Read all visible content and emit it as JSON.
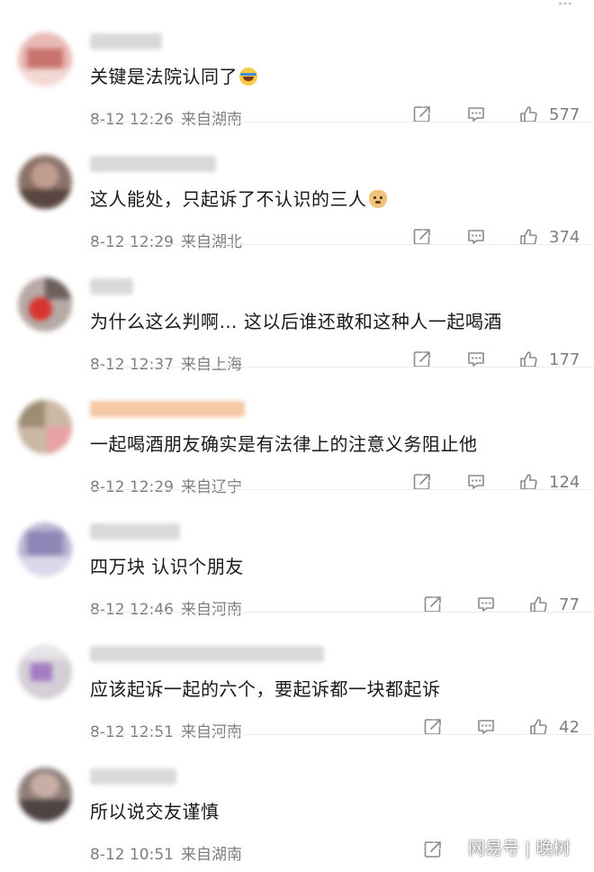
{
  "header_partial_text": "...",
  "colors": {
    "meta_gray": "#7d7d7d",
    "icon_gray": "#8a8a8a"
  },
  "comments": [
    {
      "text": "关键是法院认同了",
      "emoji": "laugh-cry-emoji",
      "date": "8-12 12:26",
      "location": "来自湖南",
      "likes": "577"
    },
    {
      "text": "这人能处，只起诉了不认识的三人",
      "emoji": "doge-emoji",
      "date": "8-12 12:29",
      "location": "来自湖北",
      "likes": "374"
    },
    {
      "text": "为什么这么判啊… 这以后谁还敢和这种人一起喝酒",
      "emoji": "",
      "date": "8-12 12:37",
      "location": "来自上海",
      "likes": "177"
    },
    {
      "text": "一起喝酒朋友确实是有法律上的注意义务阻止他",
      "emoji": "",
      "date": "8-12 12:29",
      "location": "来自辽宁",
      "likes": "124"
    },
    {
      "text": "四万块 认识个朋友",
      "emoji": "",
      "date": "8-12 12:46",
      "location": "来自河南",
      "likes": "77"
    },
    {
      "text": "应该起诉一起的六个，要起诉都一块都起诉",
      "emoji": "",
      "date": "8-12 12:51",
      "location": "来自河南",
      "likes": "42"
    },
    {
      "text": "所以说交友谨慎",
      "emoji": "",
      "date": "8-12 10:51",
      "location": "来自湖南",
      "likes": ""
    }
  ],
  "watermark": "网易号 | 晚树"
}
